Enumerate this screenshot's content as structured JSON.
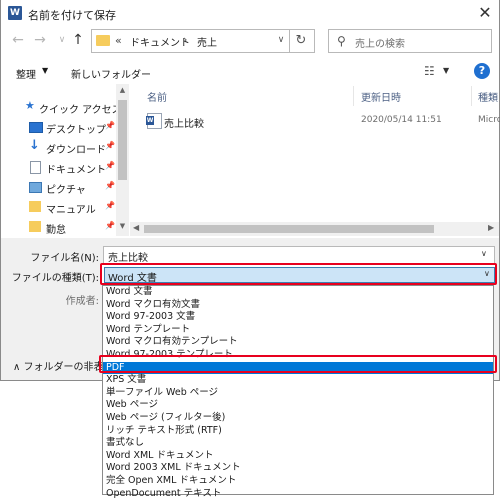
{
  "window": {
    "title": "名前を付けて保存",
    "app_icon_letter": "W",
    "close_glyph": "✕"
  },
  "nav": {
    "back_glyph": "←",
    "forward_glyph": "→",
    "recent_glyph": "∨",
    "up_glyph": "↑",
    "address_back_glyph": "«",
    "address_segments": [
      "ドキュメント",
      "売上"
    ],
    "address_separator": "›",
    "address_dropdown_glyph": "∨",
    "refresh_glyph": "↻",
    "search_glyph": "⚲",
    "search_placeholder": "売上の検索"
  },
  "toolbar": {
    "organize_label": "整理",
    "organize_dd": "▼",
    "new_folder_label": "新しいフォルダー",
    "view_glyph": "☷",
    "view_dd": "▼",
    "help_glyph": "?"
  },
  "sidebar": {
    "scroll_up": "▲",
    "scroll_down": "▼",
    "items": [
      {
        "label": "クイック アクセス",
        "icon": "star-icon",
        "pinned": false
      },
      {
        "label": "デスクトップ",
        "icon": "desktop-icon",
        "pinned": true
      },
      {
        "label": "ダウンロード",
        "icon": "download-icon",
        "pinned": true
      },
      {
        "label": "ドキュメント",
        "icon": "document-icon",
        "pinned": true
      },
      {
        "label": "ピクチャ",
        "icon": "picture-icon",
        "pinned": true
      },
      {
        "label": "マニュアル",
        "icon": "folder-icon",
        "pinned": true
      },
      {
        "label": "勤怠",
        "icon": "folder-icon",
        "pinned": true
      }
    ],
    "pin_glyph": "📌"
  },
  "filelist": {
    "columns": [
      "名前",
      "更新日時",
      "種類"
    ],
    "rows": [
      {
        "name": "売上比較",
        "modified": "2020/05/14 11:51",
        "type": "Micro"
      }
    ],
    "scroll_left": "◀",
    "scroll_right": "▶"
  },
  "form": {
    "filename_label": "ファイル名(N):",
    "filename_value": "売上比較",
    "filetype_label": "ファイルの種類(T):",
    "filetype_value": "Word 文書",
    "author_label": "作成者:",
    "dd_glyph": "∨",
    "hide_folders_label": "∧ フォルダーの非表示"
  },
  "filetype_options": [
    "Word 文書",
    "Word マクロ有効文書",
    "Word 97-2003 文書",
    "Word テンプレート",
    "Word マクロ有効テンプレート",
    "Word 97-2003 テンプレート",
    "PDF",
    "XPS 文書",
    "単一ファイル Web ページ",
    "Web ページ",
    "Web ページ (フィルター後)",
    "リッチ テキスト形式 (RTF)",
    "書式なし",
    "Word XML ドキュメント",
    "Word 2003 XML ドキュメント",
    "完全 Open XML ドキュメント",
    "OpenDocument テキスト"
  ],
  "selected_option": "PDF",
  "colors": {
    "highlight_red": "#e8001e",
    "selection_blue": "#0078d7",
    "folder_yellow": "#f6cc5d",
    "word_blue": "#2b5797"
  }
}
